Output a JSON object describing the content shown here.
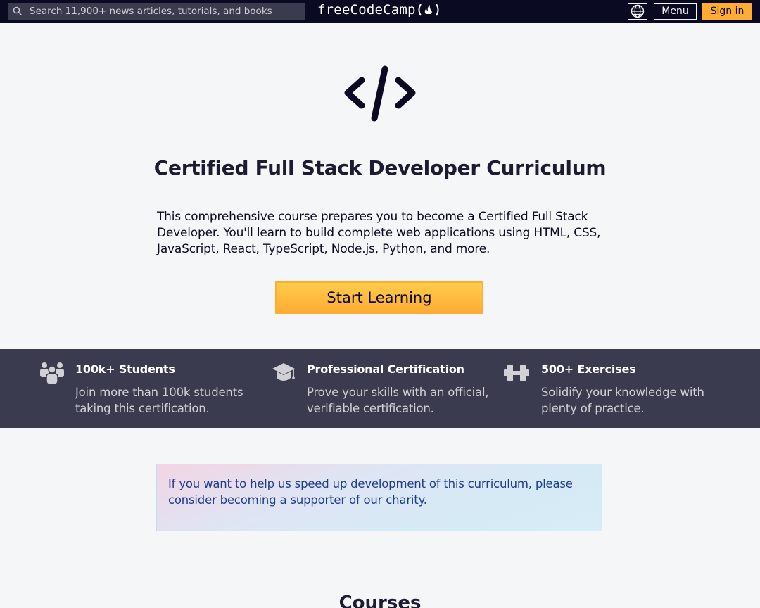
{
  "nav": {
    "search_placeholder": "Search 11,900+ news articles, tutorials, and books",
    "logo_text": "freeCodeCamp",
    "logo_icon": "flame-icon",
    "language_icon": "globe-icon",
    "menu_label": "Menu",
    "signin_label": "Sign in"
  },
  "hero": {
    "icon": "code-brackets-icon",
    "title": "Certified Full Stack Developer Curriculum",
    "description": "This comprehensive course prepares you to become a Certified Full Stack Developer. You'll learn to build complete web applications using HTML, CSS, JavaScript, React, TypeScript, Node.js, Python, and more.",
    "cta_label": "Start Learning"
  },
  "features": [
    {
      "icon": "users-icon",
      "title": "100k+ Students",
      "description": "Join more than 100k students taking this certification."
    },
    {
      "icon": "graduation-cap-icon",
      "title": "Professional Certification",
      "description": "Prove your skills with an official, verifiable certification."
    },
    {
      "icon": "dumbbell-icon",
      "title": "500+ Exercises",
      "description": "Solidify your knowledge with plenty of practice."
    }
  ],
  "notice": {
    "text": "If you want to help us speed up development of this curriculum, please ",
    "link_text": "consider becoming a supporter of our charity."
  },
  "courses_heading": "Courses",
  "colors": {
    "nav_bg": "#0a0a23",
    "accent_yellow": "#feac32",
    "band_bg": "#3b3b4f",
    "notice_text": "#1d3c8e",
    "page_bg": "#f5f6f7"
  }
}
